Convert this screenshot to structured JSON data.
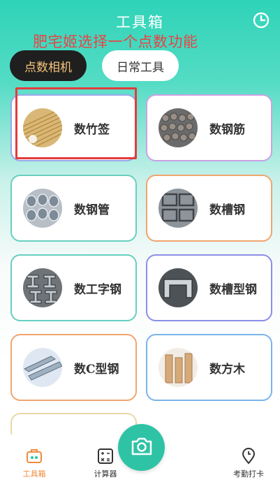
{
  "header": {
    "title": "工具箱"
  },
  "annotation": "肥宅姬选择一个点数功能",
  "tabs": [
    {
      "label": "点数相机",
      "active": true
    },
    {
      "label": "日常工具",
      "active": false
    }
  ],
  "cards": [
    {
      "label": "数竹签",
      "icon": "bamboo-sticks-image",
      "border": "#9aa7e8",
      "highlighted": true
    },
    {
      "label": "数钢筋",
      "icon": "rebar-image",
      "border": "#c9a2e6"
    },
    {
      "label": "数钢管",
      "icon": "steel-pipe-image",
      "border": "#67cfc0"
    },
    {
      "label": "数槽钢",
      "icon": "channel-steel-image",
      "border": "#f1a56e"
    },
    {
      "label": "数工字钢",
      "icon": "i-beam-image",
      "border": "#67cfc0"
    },
    {
      "label": "数槽型钢",
      "icon": "channel-section-image",
      "border": "#8b8ee8"
    },
    {
      "label": "数C型钢",
      "icon": "c-steel-image",
      "border": "#f1a56e"
    },
    {
      "label": "数方木",
      "icon": "square-timber-image",
      "border": "#7ab4ea"
    }
  ],
  "tabbar": {
    "items": [
      {
        "label": "工具箱",
        "icon": "toolbox-icon",
        "color": "#f08a3c"
      },
      {
        "label": "计算器",
        "icon": "calculator-icon"
      },
      {
        "label": "考勤打卡",
        "icon": "location-clock-icon"
      }
    ],
    "camera_icon": "camera-icon",
    "accent": "#2fc3a6"
  }
}
